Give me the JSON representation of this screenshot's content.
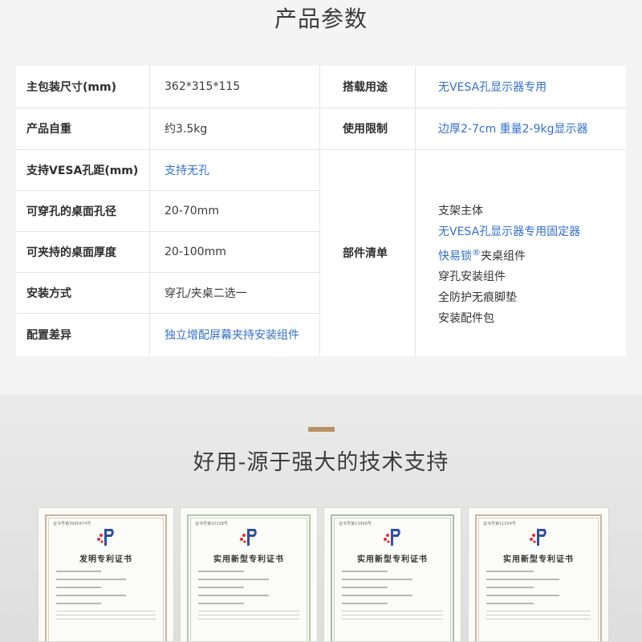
{
  "section1": {
    "title": "产品参数"
  },
  "specs": {
    "rows": [
      {
        "label": "主包装尺寸(mm)",
        "value": "362*315*115"
      },
      {
        "label": "产品自重",
        "value": "约3.5kg"
      },
      {
        "label": "支持VESA孔距(mm)",
        "value": "支持无孔"
      },
      {
        "label": "可穿孔的桌面孔径",
        "value": "20-70mm"
      },
      {
        "label": "可夹持的桌面厚度",
        "value": "20-100mm"
      },
      {
        "label": "安装方式",
        "value": "穿孔/夹桌二选一"
      },
      {
        "label": "配置差异",
        "value": "独立增配屏幕夹持安装组件"
      }
    ],
    "right_rows": [
      {
        "label": "搭载用途",
        "value": "无VESA孔显示器专用"
      },
      {
        "label": "使用限制",
        "value": "边厚2-7cm 重量2-9kg显示器"
      }
    ],
    "parts_label": "部件清单",
    "parts": [
      "支架主体",
      "无VESA孔显示器专用固定器",
      "快易锁",
      "夹桌组件",
      "穿孔安装组件",
      "全防护无痕脚垫",
      "安装配件包"
    ],
    "registered_mark": "®",
    "accent_blue": "#3470c9"
  },
  "section2": {
    "title": "好用-源于强大的技术支持",
    "accent_gold": "#b99164"
  },
  "certificates": [
    {
      "title": "发明专利证书",
      "number": "证书号第3985474号"
    },
    {
      "title": "实用新型专利证书",
      "number": "证书号第10198号"
    },
    {
      "title": "实用新型专利证书",
      "number": "证书号第13498号"
    },
    {
      "title": "实用新型专利证书",
      "number": "证书号第11094号"
    }
  ]
}
